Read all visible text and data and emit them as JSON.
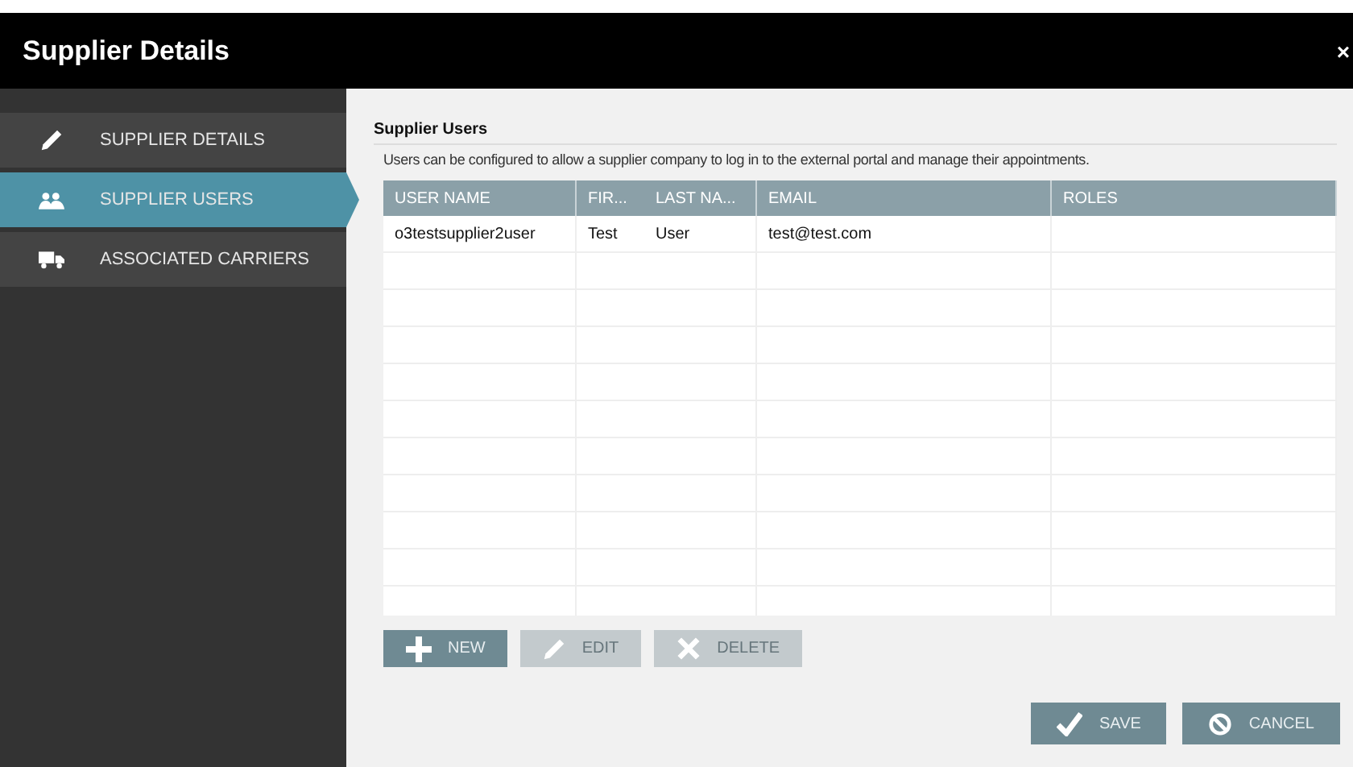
{
  "window": {
    "title": "Supplier Details",
    "close": "×"
  },
  "sidebar": {
    "items": [
      {
        "label": "SUPPLIER DETAILS",
        "selected": false
      },
      {
        "label": "SUPPLIER USERS",
        "selected": true
      },
      {
        "label": "ASSOCIATED CARRIERS",
        "selected": false
      }
    ]
  },
  "section": {
    "title": "Supplier Users",
    "description": "Users can be configured to allow a supplier company to log in to the external portal and manage their appointments."
  },
  "table": {
    "columns": [
      "USER NAME",
      "FIR...",
      "LAST NA...",
      "EMAIL",
      "ROLES"
    ],
    "rows": [
      [
        "o3testsupplier2user",
        "Test",
        "User",
        "test@test.com",
        ""
      ]
    ]
  },
  "actions": [
    {
      "label": "NEW",
      "disabled": false
    },
    {
      "label": "EDIT",
      "disabled": true
    },
    {
      "label": "DELETE",
      "disabled": true
    }
  ],
  "footer_buttons": [
    {
      "label": "SAVE"
    },
    {
      "label": "CANCEL"
    }
  ]
}
